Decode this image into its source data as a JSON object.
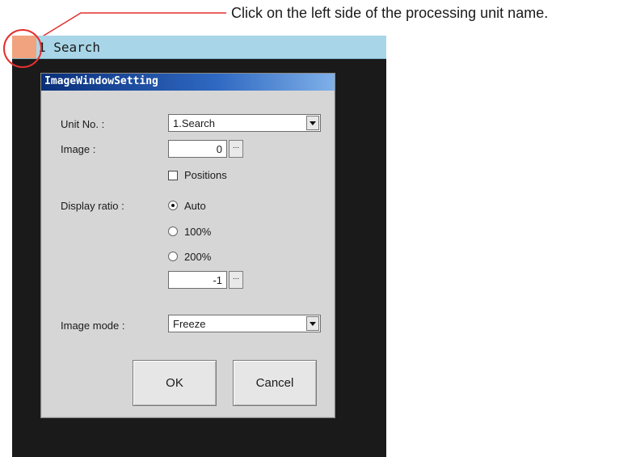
{
  "callout": {
    "text": "Click on the left side of the processing unit name."
  },
  "unit_window": {
    "title": "1 Search"
  },
  "dialog": {
    "title": "ImageWindowSetting",
    "unit_no": {
      "label": "Unit No. :",
      "value": "1.Search"
    },
    "image": {
      "label": "Image :",
      "value": "0",
      "browse": "..."
    },
    "positions": {
      "label": "Positions",
      "checked": false
    },
    "display_ratio": {
      "label": "Display ratio :",
      "options": [
        "Auto",
        "100%",
        "200%"
      ],
      "selected": "Auto",
      "value": "-1",
      "browse": "..."
    },
    "image_mode": {
      "label": "Image mode :",
      "value": "Freeze"
    },
    "ok_label": "OK",
    "cancel_label": "Cancel"
  },
  "colors": {
    "titlebar": "#a8d6e8",
    "marker": "#f0a37e",
    "highlight_circle": "#e3302f"
  }
}
